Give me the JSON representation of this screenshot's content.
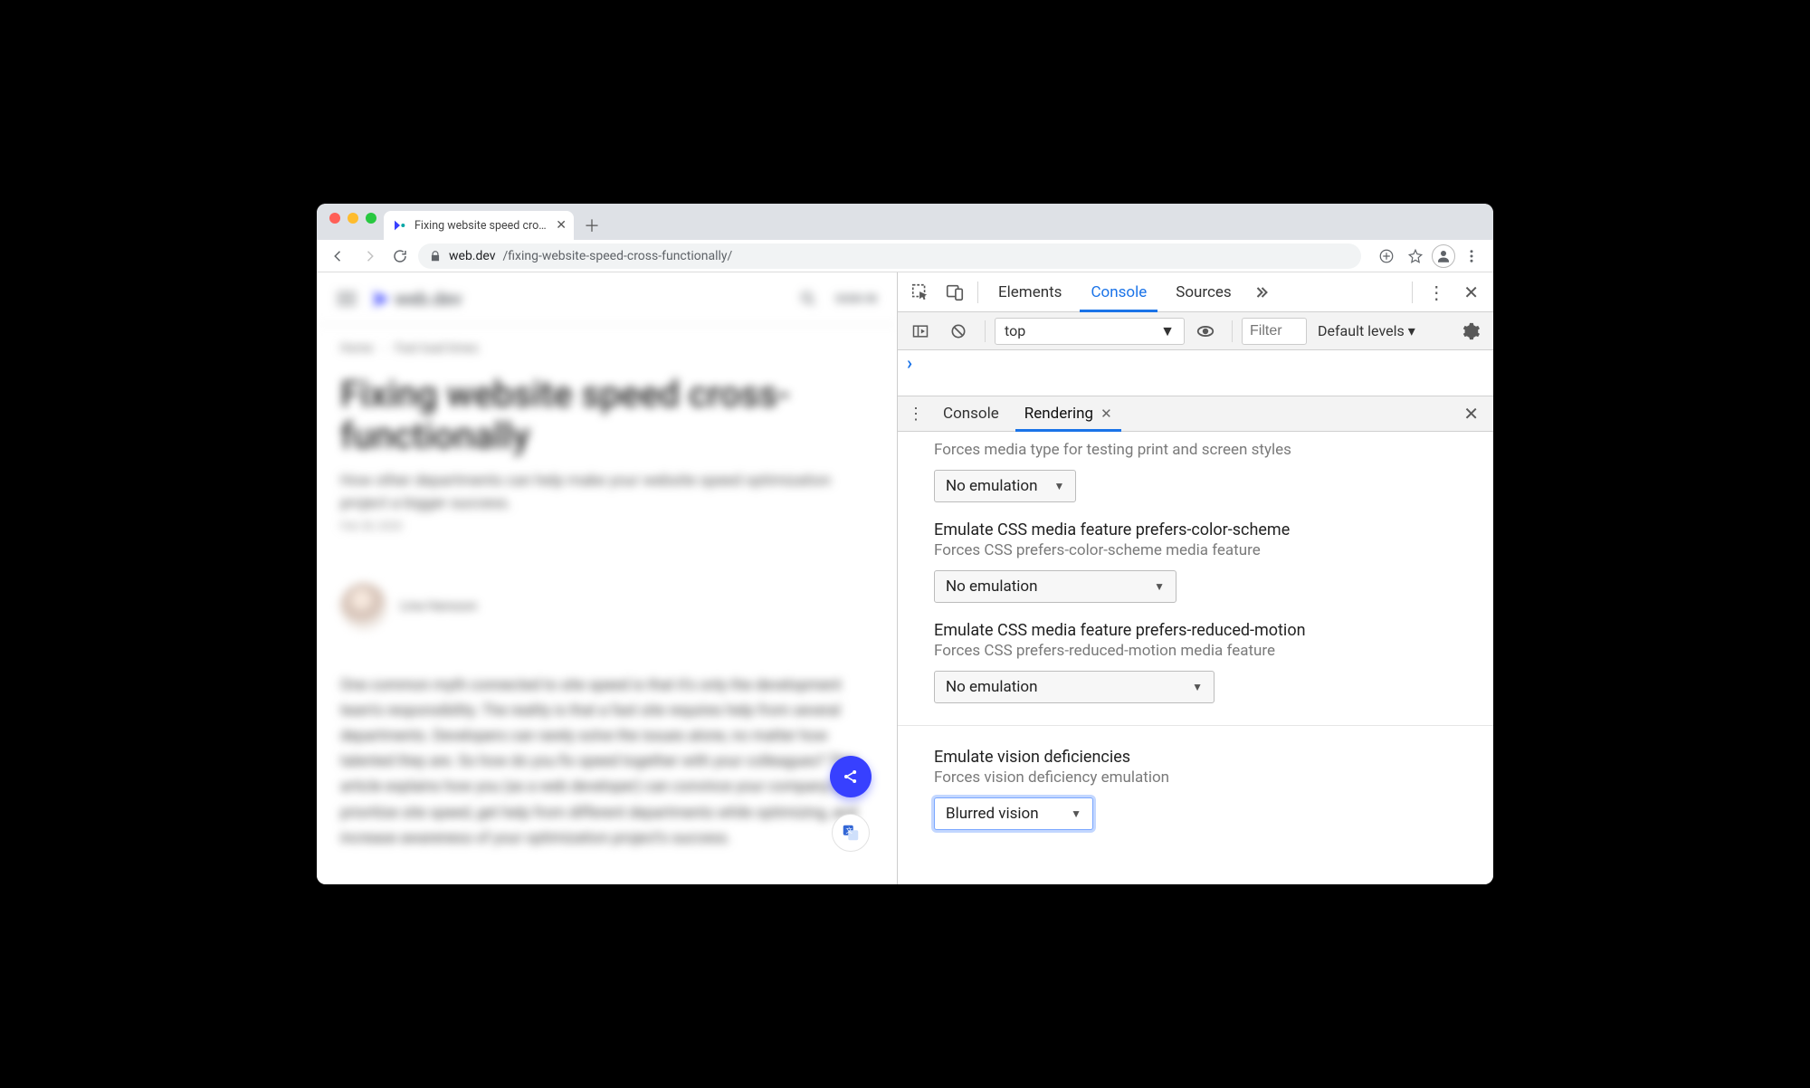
{
  "browser": {
    "tab_title": "Fixing website speed cross-fun",
    "url_host": "web.dev",
    "url_path": "/fixing-website-speed-cross-functionally/"
  },
  "page": {
    "brand": "web.dev",
    "signin": "SIGN IN",
    "crumb_home": "Home",
    "crumb_section": "Fast load times",
    "title": "Fixing website speed cross-functionally",
    "subtitle": "How other departments can help make your website speed optimization project a bigger success.",
    "date": "Feb 28, 2020",
    "author": "Lina Hansson",
    "body": "One common myth connected to site speed is that it's only the development team's responsibility. The reality is that a fast site requires help from several departments. Developers can rarely solve the issues alone, no matter how talented they are. So how do you fix speed together with your colleagues? This article explains how you (as a web developer) can convince your company to prioritize site speed, get help from different departments while optimizing, and increase awareness of your optimization project's success."
  },
  "devtools": {
    "tabs": {
      "elements": "Elements",
      "console": "Console",
      "sources": "Sources"
    },
    "console_bar": {
      "context": "top",
      "filter_placeholder": "Filter",
      "levels": "Default levels ▾"
    },
    "drawer_tabs": {
      "console": "Console",
      "rendering": "Rendering"
    },
    "rendering": {
      "media_type": {
        "desc": "Forces media type for testing print and screen styles",
        "value": "No emulation"
      },
      "color_scheme": {
        "title": "Emulate CSS media feature prefers-color-scheme",
        "desc": "Forces CSS prefers-color-scheme media feature",
        "value": "No emulation"
      },
      "reduced_motion": {
        "title": "Emulate CSS media feature prefers-reduced-motion",
        "desc": "Forces CSS prefers-reduced-motion media feature",
        "value": "No emulation"
      },
      "vision": {
        "title": "Emulate vision deficiencies",
        "desc": "Forces vision deficiency emulation",
        "value": "Blurred vision"
      }
    }
  }
}
